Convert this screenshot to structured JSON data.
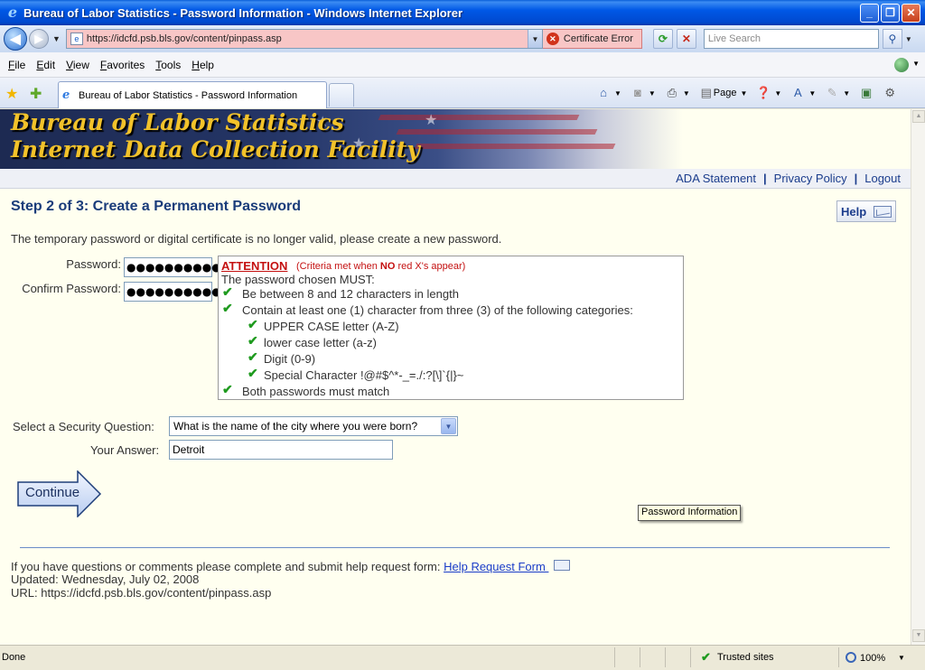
{
  "window": {
    "title": "Bureau of Labor Statistics - Password Information - Windows Internet Explorer",
    "minimize": "_",
    "maximize": "❐",
    "close": "✕"
  },
  "address_bar": {
    "url": "https://idcfd.psb.bls.gov/content/pinpass.asp",
    "cert_error": "Certificate Error",
    "search_placeholder": "Live Search"
  },
  "menu": {
    "items": [
      {
        "key": "F",
        "rest": "ile"
      },
      {
        "key": "E",
        "rest": "dit"
      },
      {
        "key": "V",
        "rest": "iew"
      },
      {
        "key": "",
        "rest": "Favorites",
        "underline_index": 0
      },
      {
        "key": "T",
        "rest": "ools"
      },
      {
        "key": "H",
        "rest": "elp"
      }
    ]
  },
  "tabs": {
    "active_tab": "Bureau of Labor Statistics - Password Information"
  },
  "toolbar": {
    "page_label": "Page"
  },
  "banner": {
    "line1": "Bureau of Labor Statistics",
    "line2": "Internet Data Collection Facility"
  },
  "top_links": [
    "ADA Statement",
    "Privacy Policy",
    "Logout"
  ],
  "page": {
    "step_title": "Step 2 of 3: Create a Permanent Password",
    "help_label": "Help",
    "intro": "The temporary password or digital certificate is no longer valid, please create a new password.",
    "password_label": "Password:",
    "password_value": "●●●●●●●●●●",
    "confirm_label": "Confirm Password:",
    "confirm_value": "●●●●●●●●●●"
  },
  "rules": {
    "attention": "ATTENTION",
    "criteria_prefix": "(Criteria met when ",
    "criteria_no": "NO",
    "criteria_suffix": " red X's appear)",
    "must": "The password chosen MUST:",
    "items": [
      {
        "text": "Be between 8 and 12 characters in length",
        "level": 0,
        "met": true
      },
      {
        "text": "Contain at least one (1) character from three (3) of the following categories:",
        "level": 0,
        "met": true
      },
      {
        "text": "UPPER CASE letter (A-Z)",
        "level": 1,
        "met": true
      },
      {
        "text": "lower case letter (a-z)",
        "level": 1,
        "met": true
      },
      {
        "text": "Digit (0-9)",
        "level": 1,
        "met": true
      },
      {
        "text": "Special Character !@#$^*-_=./:?[\\]`{|}~",
        "level": 1,
        "met": true
      },
      {
        "text": "Both passwords must match",
        "level": 0,
        "met": true
      }
    ]
  },
  "security": {
    "question_label": "Select a Security Question:",
    "question_value": "What is the name of the city where you were born?",
    "answer_label": "Your Answer:",
    "answer_value": "Detroit"
  },
  "continue_label": "Continue",
  "tooltip": "Password Information",
  "footer": {
    "line1": "If you have questions or comments please complete and submit help request form: ",
    "help_link": "Help Request Form ",
    "updated": "Updated: Wednesday, July 02, 2008",
    "url": "URL: https://idcfd.psb.bls.gov/content/pinpass.asp"
  },
  "status": {
    "left": "Done",
    "zone": "Trusted sites",
    "zoom": "100%"
  }
}
